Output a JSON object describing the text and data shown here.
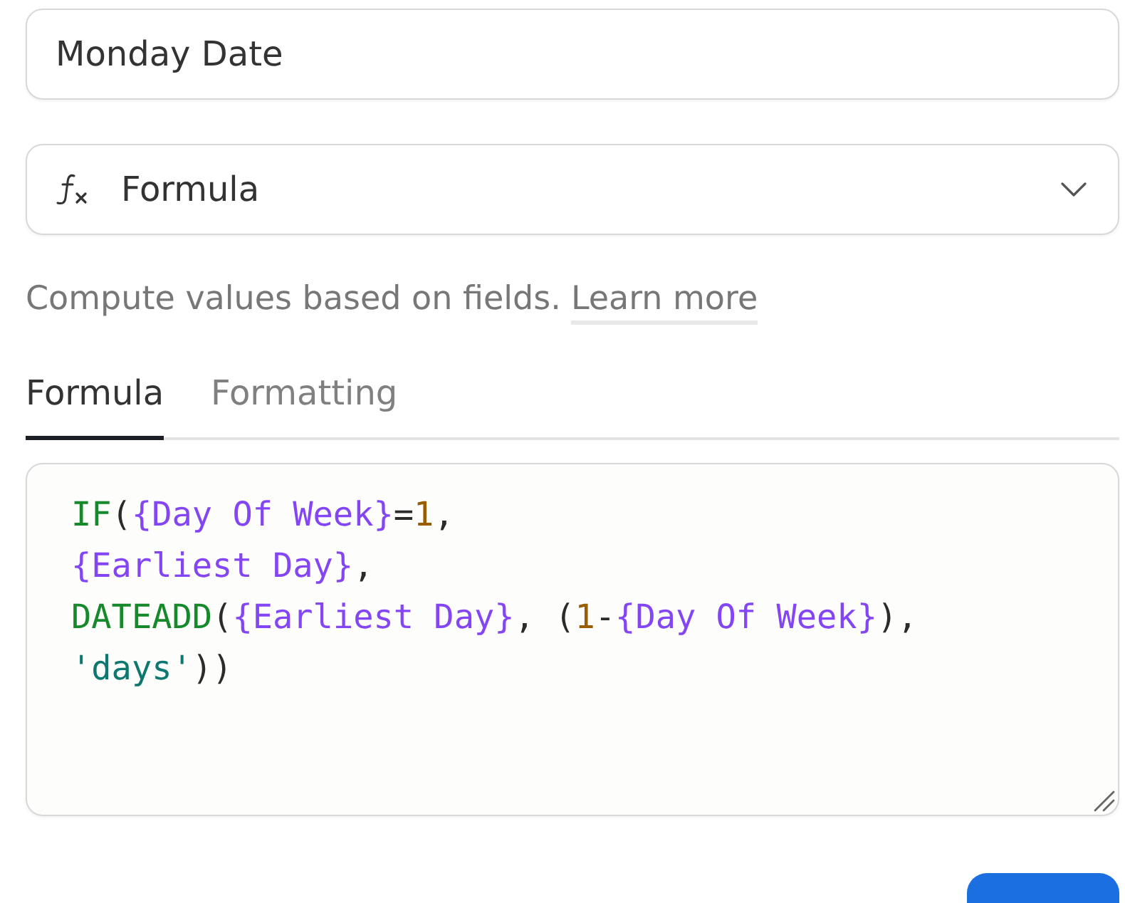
{
  "name_field": {
    "value": "Monday Date"
  },
  "type_dropdown": {
    "value": "Formula"
  },
  "description": {
    "text": "Compute values based on fields.",
    "link": "Learn more"
  },
  "tabs": [
    {
      "label": "Formula",
      "selected": true
    },
    {
      "label": "Formatting",
      "selected": false
    }
  ],
  "formula": {
    "lines": [
      [
        {
          "kind": "function",
          "text": "IF"
        },
        {
          "kind": "punct",
          "text": "("
        },
        {
          "kind": "field",
          "text": "{Day Of Week}"
        },
        {
          "kind": "punct",
          "text": "="
        },
        {
          "kind": "number",
          "text": "1"
        },
        {
          "kind": "punct",
          "text": ","
        }
      ],
      [
        {
          "kind": "field",
          "text": "{Earliest Day}"
        },
        {
          "kind": "punct",
          "text": ","
        }
      ],
      [
        {
          "kind": "function",
          "text": "DATEADD"
        },
        {
          "kind": "punct",
          "text": "("
        },
        {
          "kind": "field",
          "text": "{Earliest Day}"
        },
        {
          "kind": "punct",
          "text": ", ("
        },
        {
          "kind": "number",
          "text": "1"
        },
        {
          "kind": "punct",
          "text": "-"
        },
        {
          "kind": "field",
          "text": "{Day Of Week}"
        },
        {
          "kind": "punct",
          "text": "),"
        }
      ],
      [
        {
          "kind": "string",
          "text": "'days'"
        },
        {
          "kind": "punct",
          "text": "))"
        }
      ]
    ]
  }
}
